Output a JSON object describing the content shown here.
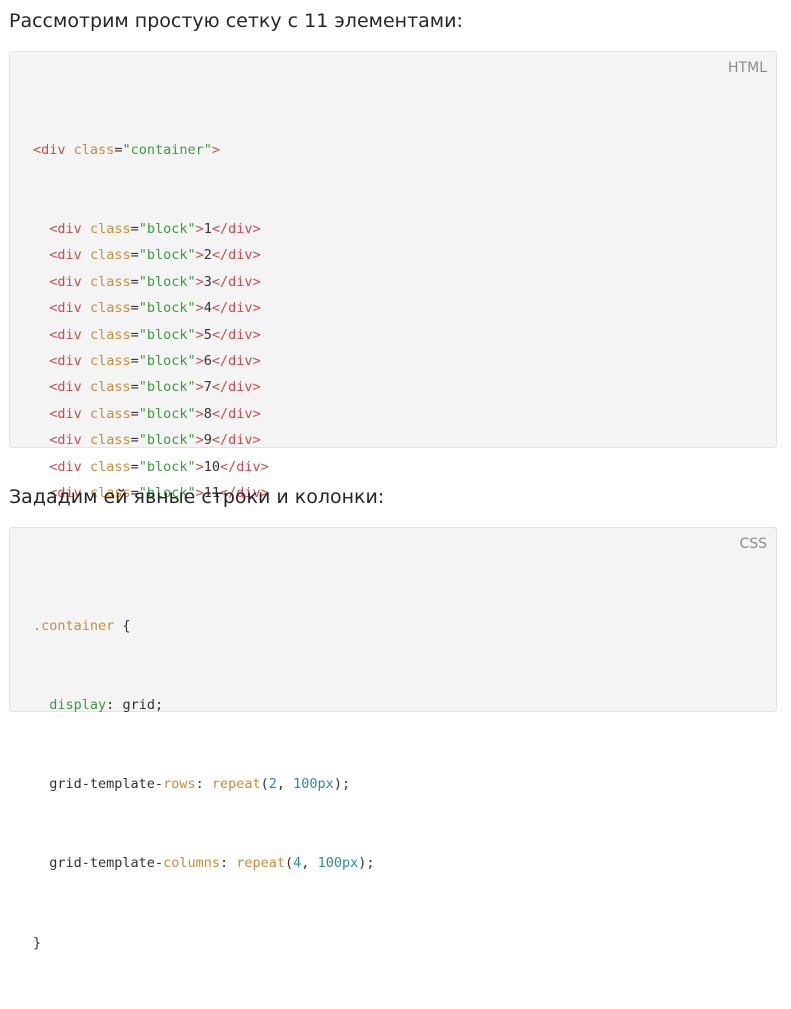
{
  "paragraphs": {
    "intro": "Рассмотрим простую сетку с 11 элементами:",
    "explicit": "Зададим ей явные строки и колонки:"
  },
  "html_block": {
    "lang_label": "HTML",
    "open_tag": "div",
    "attr_name": "class",
    "container_value": "\"container\"",
    "block_value": "\"block\"",
    "items": [
      "1",
      "2",
      "3",
      "4",
      "5",
      "6",
      "7",
      "8",
      "9",
      "10",
      "11"
    ]
  },
  "css_block": {
    "lang_label": "CSS",
    "selector": ".container",
    "open_brace": " {",
    "close_brace": "}",
    "decl_display_prop": "display",
    "decl_display_value": " grid;",
    "decl_rows_prop_a": "grid-template-",
    "decl_rows_prop_b": "rows",
    "decl_cols_prop_a": "grid-template-",
    "decl_cols_prop_b": "columns",
    "repeat_fn": "repeat",
    "rows_count": "2",
    "cols_count": "4",
    "size": "100px"
  },
  "colors": {
    "tag": "#c94d4d",
    "attr": "#c98d3a",
    "string": "#3c9c3c",
    "number": "#2d8aa0",
    "code_background": "#f4f4f4"
  }
}
